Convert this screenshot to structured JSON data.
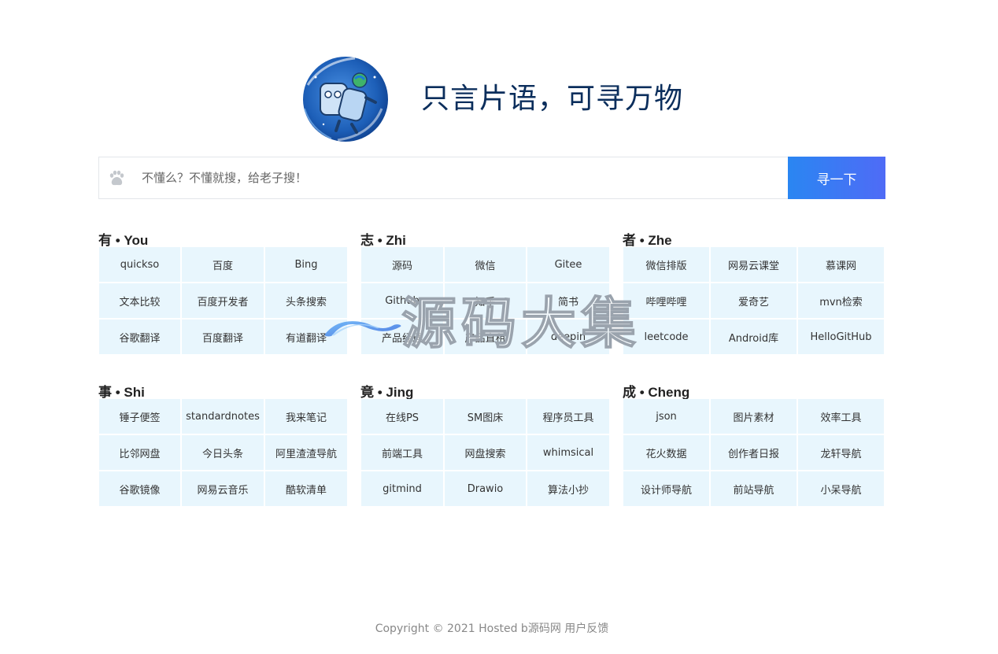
{
  "header": {
    "slogan": "只言片语，可寻万物"
  },
  "search": {
    "placeholder": "不懂么？不懂就搜，给老子搜！",
    "button_label": "寻一下"
  },
  "groups": [
    {
      "title": "有 • You",
      "items": [
        "quickso",
        "百度",
        "Bing",
        "文本比较",
        "百度开发者",
        "头条搜索",
        "谷歌翻译",
        "百度翻译",
        "有道翻译"
      ]
    },
    {
      "title": "志 • Zhi",
      "items": [
        "源码",
        "微信",
        "Gitee",
        "Github",
        "知乎",
        "简书",
        "产品经理",
        "产品直租",
        "deepin"
      ]
    },
    {
      "title": "者 • Zhe",
      "items": [
        "微信排版",
        "网易云课堂",
        "慕课网",
        "哔哩哔哩",
        "爱奇艺",
        "mvn检索",
        "leetcode",
        "Android库",
        "HelloGitHub"
      ]
    },
    {
      "title": "事 • Shi",
      "items": [
        "锤子便签",
        "standardnotes",
        "我来笔记",
        "比邻网盘",
        "今日头条",
        "阿里渣渣导航",
        "谷歌镜像",
        "网易云音乐",
        "酷软清单"
      ]
    },
    {
      "title": "竟 • Jing",
      "items": [
        "在线PS",
        "SM图床",
        "程序员工具",
        "前端工具",
        "网盘搜索",
        "whimsical",
        "gitmind",
        "Drawio",
        "算法小抄"
      ]
    },
    {
      "title": "成 • Cheng",
      "items": [
        "json",
        "图片素材",
        "效率工具",
        "花火数据",
        "创作者日报",
        "龙轩导航",
        "设计师导航",
        "前站导航",
        "小呆导航"
      ]
    }
  ],
  "watermark": {
    "text": "源码大集"
  },
  "footer": {
    "copyright": "Copyright © 2021 Hosted b源码网 用户反馈"
  },
  "colors": {
    "cell_background": "#e8f6fd",
    "button_gradient_start": "#2a86f2",
    "button_gradient_end": "#4f6bf6",
    "slogan": "#0b2e5c"
  }
}
